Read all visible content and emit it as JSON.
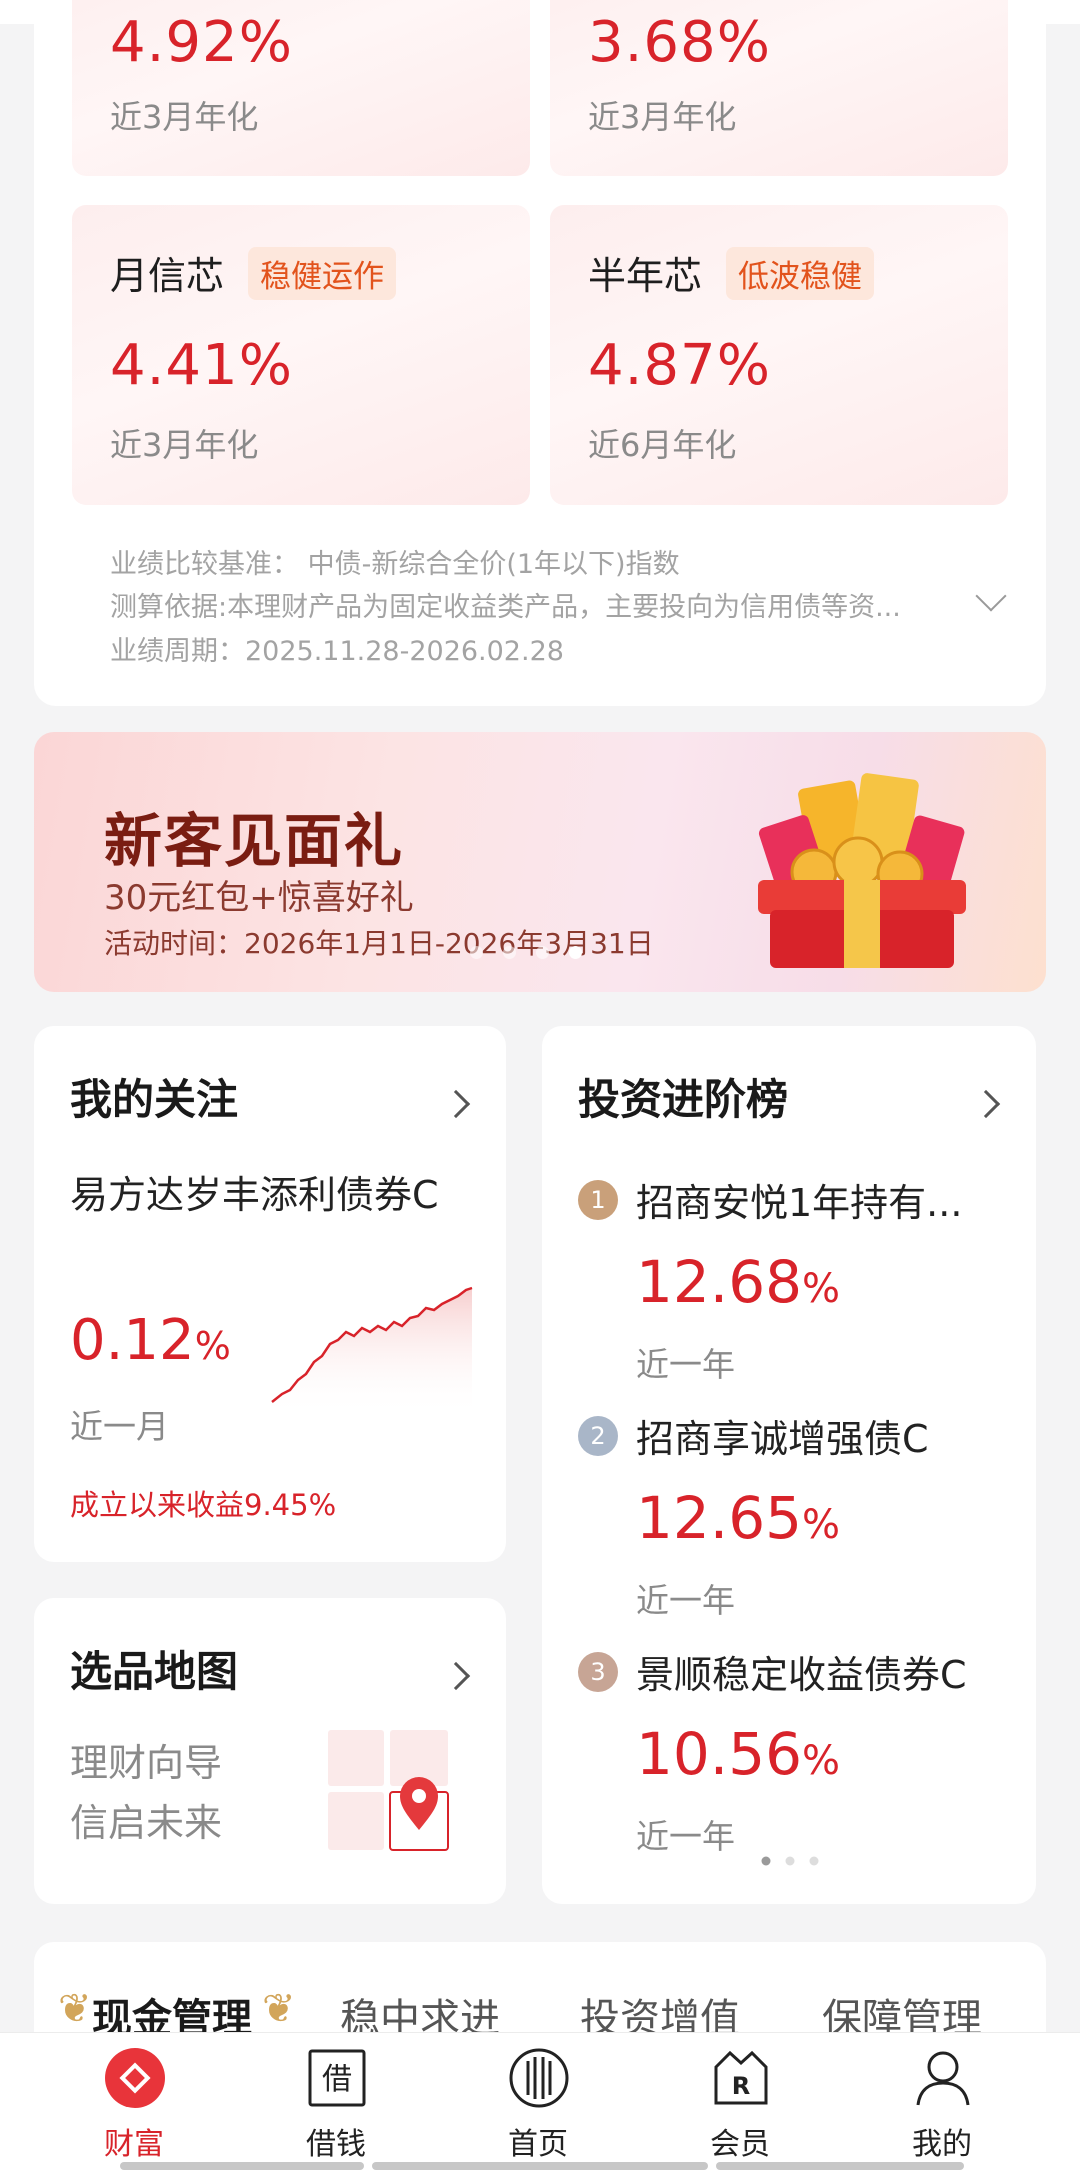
{
  "colors": {
    "accent": "#d8232a",
    "tag_text": "#e2531c",
    "tag_bg": "#fde7dc",
    "muted": "#8a8a8a"
  },
  "top_tiles": [
    {
      "name": "",
      "tag": "",
      "rate": "4.92%",
      "desc": "近3月年化"
    },
    {
      "name": "",
      "tag": "",
      "rate": "3.68%",
      "desc": "近3月年化"
    },
    {
      "name": "月信芯",
      "tag": "稳健运作",
      "rate": "4.41%",
      "desc": "近3月年化"
    },
    {
      "name": "半年芯",
      "tag": "低波稳健",
      "rate": "4.87%",
      "desc": "近6月年化"
    }
  ],
  "benchmark": {
    "line1": "业绩比较基准： 中债-新综合全价(1年以下)指数",
    "line2": "测算依据:本理财产品为固定收益类产品，主要投向为信用债等资...",
    "line3": "业绩周期：2025.11.28-2026.02.28",
    "expand_icon": "chevron-down-icon"
  },
  "banner": {
    "title": "新客见面礼",
    "subtitle": "30元红包+惊喜好礼",
    "time": "活动时间：2026年1月1日-2026年3月31日",
    "page_count": 4,
    "active_page": 4
  },
  "watchlist": {
    "title": "我的关注",
    "fund": "易方达岁丰添利债券C",
    "value": "0.12",
    "unit": "%",
    "period": "近一月",
    "since_inception": "成立以来收益9.45%"
  },
  "ranking": {
    "title": "投资进阶榜",
    "items": [
      {
        "rank": "1",
        "name": "招商安悦1年持有...",
        "value": "12.68",
        "unit": "%",
        "period": "近一年",
        "badge_color": "#c9a07a"
      },
      {
        "rank": "2",
        "name": "招商享诚增强债C",
        "value": "12.65",
        "unit": "%",
        "period": "近一年",
        "badge_color": "#a9b6c8"
      },
      {
        "rank": "3",
        "name": "景顺稳定收益债券C",
        "value": "10.56",
        "unit": "%",
        "period": "近一年",
        "badge_color": "#c7a595"
      }
    ],
    "page_count": 3,
    "active_page": 1
  },
  "product_map": {
    "title": "选品地图",
    "line1": "理财向导",
    "line2": "信启未来",
    "icon": "map-pin-icon"
  },
  "category_tabs": {
    "items": [
      "现金管理",
      "稳中求进",
      "投资增值",
      "保障管理"
    ],
    "active": 0,
    "laurel_left": "❦",
    "laurel_right": "❦"
  },
  "bottom_nav": {
    "items": [
      {
        "label": "财富",
        "icon": "wealth-icon"
      },
      {
        "label": "借钱",
        "icon": "borrow-icon"
      },
      {
        "label": "首页",
        "icon": "home-icon"
      },
      {
        "label": "会员",
        "icon": "member-icon"
      },
      {
        "label": "我的",
        "icon": "profile-icon"
      }
    ],
    "active": 0,
    "borrow_glyph": "借",
    "member_glyph": "R"
  }
}
